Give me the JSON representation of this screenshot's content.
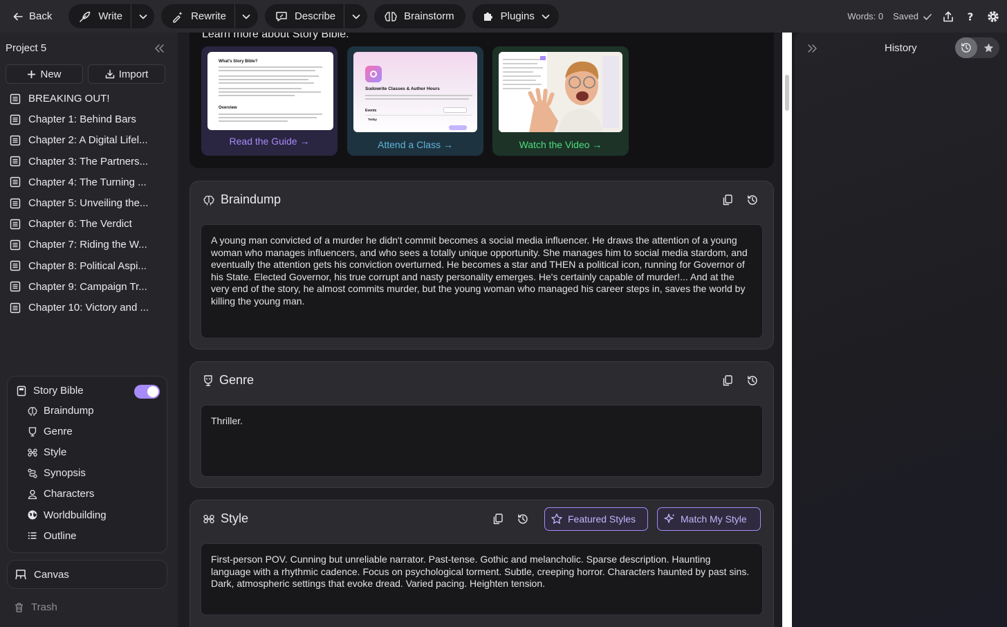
{
  "topbar": {
    "back_label": "Back",
    "write_label": "Write",
    "rewrite_label": "Rewrite",
    "describe_label": "Describe",
    "brainstorm_label": "Brainstorm",
    "plugins_label": "Plugins",
    "words_label": "Words: 0",
    "saved_label": "Saved"
  },
  "sidebar": {
    "project_name": "Project 5",
    "new_label": "New",
    "import_label": "Import",
    "documents": [
      "BREAKING OUT!",
      "Chapter 1: Behind Bars",
      "Chapter 2: A Digital Lifel...",
      "Chapter 3: The Partners...",
      "Chapter 4: The Turning ...",
      "Chapter 5: Unveiling the...",
      "Chapter 6: The Verdict",
      "Chapter 7: Riding the W...",
      "Chapter 8: Political Aspi...",
      "Chapter 9: Campaign Tr...",
      "Chapter 10: Victory and ..."
    ],
    "story_bible": {
      "label": "Story Bible",
      "enabled": true,
      "items": [
        "Braindump",
        "Genre",
        "Style",
        "Synopsis",
        "Characters",
        "Worldbuilding",
        "Outline"
      ]
    },
    "canvas_label": "Canvas",
    "trash_label": "Trash"
  },
  "learn": {
    "title": "Learn more about Story Bible.",
    "guide": {
      "link": "Read the Guide →",
      "thumb_title": "What's Story Bible?",
      "thumb_heading2": "Overview"
    },
    "class": {
      "link": "Attend a Class →",
      "thumb_title": "Sudowrite Classes & Author Hours",
      "thumb_events": "Events",
      "thumb_today": "Today"
    },
    "video": {
      "link": "Watch the Video →"
    }
  },
  "braindump": {
    "title": "Braindump",
    "text": "A young man convicted of a murder he didn't commit becomes a social media influencer. He draws the attention of a young woman who manages influencers, and who sees a totally unique opportunity. She manages him to social media stardom, and eventually the attention gets his conviction overturned. He becomes a star and THEN a political icon, running for Governor of his State. Elected Governor, his true corrupt and nasty personality emerges. He's certainly capable of murder!... And at the very end of the story, he almost commits murder, but the young woman who managed his career steps in, saves the world by killing the young man."
  },
  "genre": {
    "title": "Genre",
    "text": "Thriller."
  },
  "style": {
    "title": "Style",
    "featured_label": "Featured Styles",
    "match_label": "Match My Style",
    "text": "First-person POV. Cunning but unreliable narrator. Past-tense. Gothic and melancholic. Sparse description. Haunting language with a rhythmic cadence. Focus on psychological torment. Subtle, creeping horror. Characters haunted by past sins. Dark, atmospheric settings that evoke dread. Varied pacing. Heighten tension."
  },
  "history": {
    "title": "History"
  },
  "colors": {
    "accent": "#a78bfa",
    "link_purple": "#a78bfa",
    "link_blue": "#5fb4d8",
    "link_green": "#4ade80"
  }
}
